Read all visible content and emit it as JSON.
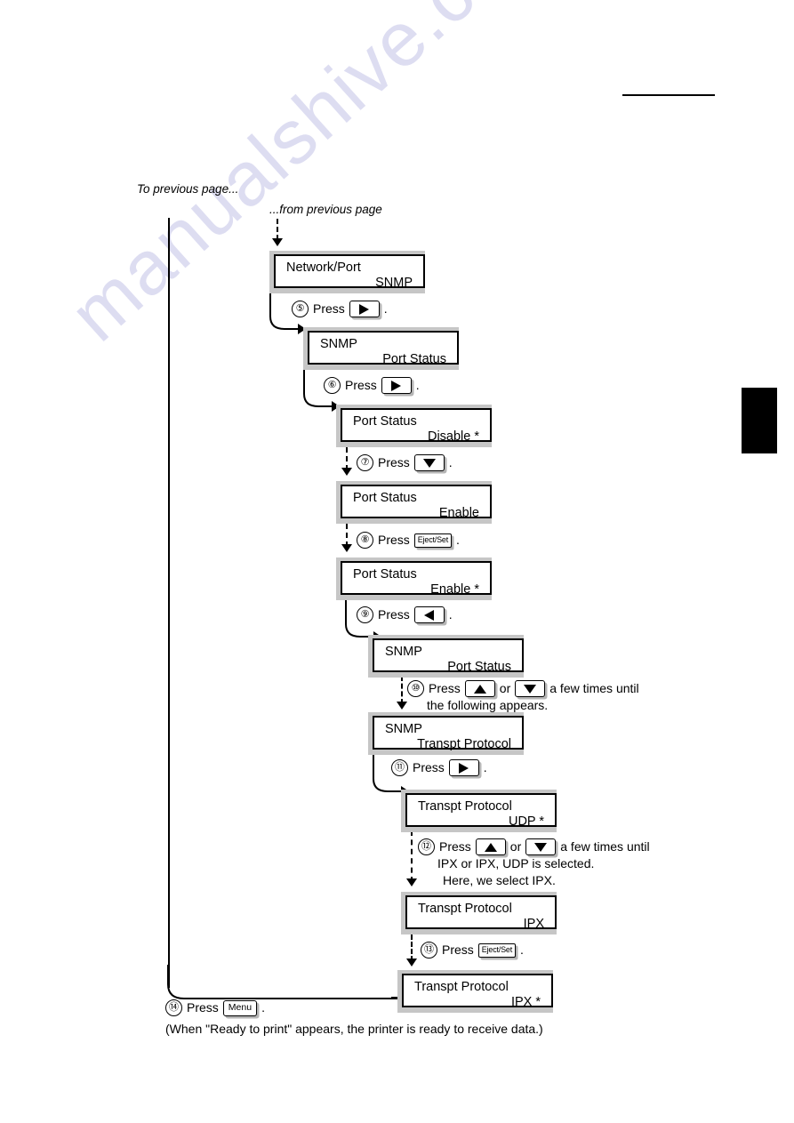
{
  "watermark": "manualshive.com",
  "page_links": {
    "to_previous": "To previous page...",
    "from_previous": "...from previous page"
  },
  "icons": {
    "right": "arrow-right-key-icon",
    "left": "arrow-left-key-icon",
    "up": "arrow-up-key-icon",
    "down": "arrow-down-key-icon",
    "eject_set": "eject-set-key-icon",
    "menu": "menu-key-icon"
  },
  "keys": {
    "eject_set_label": "Eject/Set",
    "menu_label": "Menu"
  },
  "words": {
    "press": "Press",
    "or": "or",
    "period": "."
  },
  "displays": [
    {
      "id": "network-port-snmp",
      "line1": "Network/Port",
      "line2": "SNMP"
    },
    {
      "id": "snmp-port-status",
      "line1": "SNMP",
      "line2": "Port Status"
    },
    {
      "id": "port-status-disable",
      "line1": "Port Status",
      "line2": "Disable *"
    },
    {
      "id": "port-status-enable",
      "line1": "Port Status",
      "line2": "Enable"
    },
    {
      "id": "port-status-enable-set",
      "line1": "Port Status",
      "line2": "Enable *"
    },
    {
      "id": "snmp-port-status-2",
      "line1": "SNMP",
      "line2": "Port Status"
    },
    {
      "id": "snmp-transpt-protocol",
      "line1": "SNMP",
      "line2": "Transpt Protocol"
    },
    {
      "id": "transpt-protocol-udp",
      "line1": "Transpt Protocol",
      "line2": "UDP *"
    },
    {
      "id": "transpt-protocol-ipx",
      "line1": "Transpt Protocol",
      "line2": "IPX"
    },
    {
      "id": "transpt-protocol-ipx-set",
      "line1": "Transpt Protocol",
      "line2": "IPX *"
    }
  ],
  "steps": [
    {
      "num": "⑤",
      "key": "right",
      "extra": "",
      "line2": "",
      "line3": ""
    },
    {
      "num": "⑥",
      "key": "right",
      "extra": "",
      "line2": "",
      "line3": ""
    },
    {
      "num": "⑦",
      "key": "down",
      "extra": "",
      "line2": "",
      "line3": ""
    },
    {
      "num": "⑧",
      "key": "eject_set",
      "extra": "",
      "line2": "",
      "line3": ""
    },
    {
      "num": "⑨",
      "key": "left",
      "extra": "",
      "line2": "",
      "line3": ""
    },
    {
      "num": "⑩",
      "key": "updown",
      "extra": "a few times until",
      "line2": "the following appears.",
      "line3": ""
    },
    {
      "num": "⑪",
      "key": "right",
      "extra": "",
      "line2": "",
      "line3": ""
    },
    {
      "num": "⑫",
      "key": "updown",
      "extra": "a few times until",
      "line2": "IPX  or IPX, UDP is selected.",
      "line3": "Here, we select IPX."
    },
    {
      "num": "⑬",
      "key": "eject_set",
      "extra": "",
      "line2": "",
      "line3": ""
    },
    {
      "num": "⑭",
      "key": "menu",
      "extra": "",
      "line2": "",
      "line3": ""
    }
  ],
  "caption": "(When \"Ready to print\" appears, the printer is ready to receive data.)"
}
